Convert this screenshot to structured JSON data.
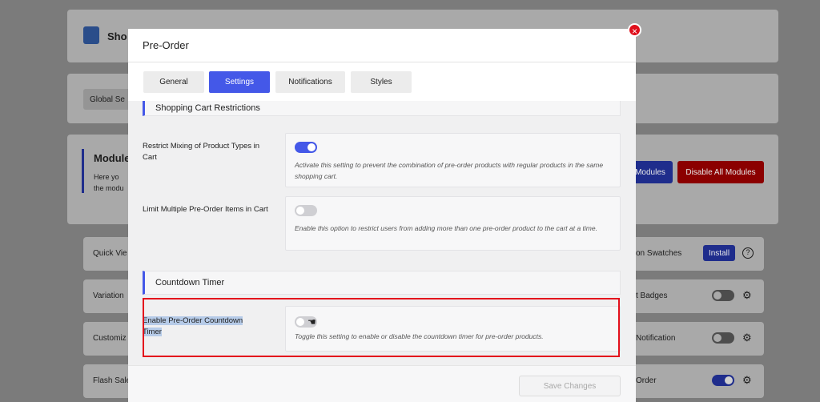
{
  "background": {
    "app_title": "Sho",
    "global_settings_tab": "Global Se",
    "modules_title": "Module",
    "modules_desc_line1": "Here yo",
    "modules_desc_line2": "the modu",
    "enable_modules_button": "Modules",
    "disable_all_button": "Disable All Modules",
    "left_items": [
      "Quick Vie",
      "Variation",
      "Customiz",
      "Flash Sale"
    ],
    "right_items": [
      {
        "label": "on Swatches",
        "control": "Install"
      },
      {
        "label": "t Badges"
      },
      {
        "label": "Notification"
      },
      {
        "label": "Order"
      }
    ],
    "install_label": "Install"
  },
  "modal": {
    "title": "Pre-Order",
    "close_symbol": "×",
    "tabs": [
      {
        "label": "General",
        "active": false
      },
      {
        "label": "Settings",
        "active": true
      },
      {
        "label": "Notifications",
        "active": false
      },
      {
        "label": "Styles",
        "active": false
      }
    ],
    "sections": {
      "cart": {
        "title": "Shopping Cart Restrictions",
        "settings": [
          {
            "label": "Restrict Mixing of Product Types in Cart",
            "enabled": true,
            "description": "Activate this setting to prevent the combination of pre-order products with regular products in the same shopping cart."
          },
          {
            "label": "Limit Multiple Pre-Order Items in Cart",
            "enabled": false,
            "description": "Enable this option to restrict users from adding more than one pre-order product to the cart at a time."
          }
        ]
      },
      "countdown": {
        "title": "Countdown Timer",
        "settings": [
          {
            "label": "Enable Pre-Order Countdown Timer",
            "enabled": false,
            "description": "Toggle this setting to enable or disable the countdown timer for pre-order products."
          }
        ]
      }
    },
    "save_button": "Save Changes"
  },
  "colors": {
    "accent": "#4458e8",
    "danger": "#e3101c",
    "disable_all": "#8b0000"
  }
}
